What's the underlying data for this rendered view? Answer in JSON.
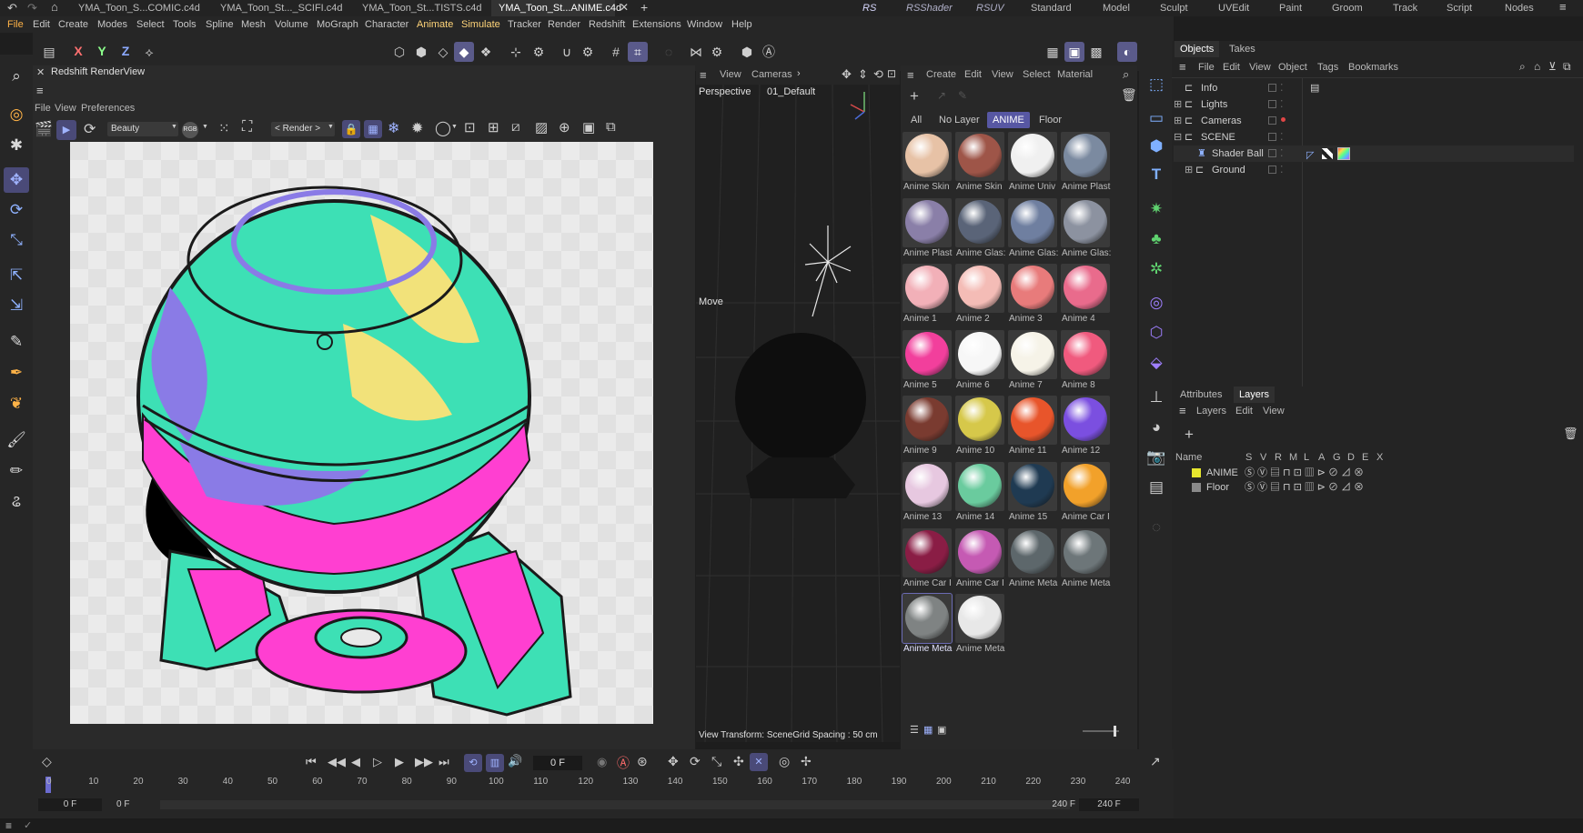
{
  "file_tabs": [
    {
      "label": "YMA_Toon_S...COMIC.c4d *",
      "active": false
    },
    {
      "label": "YMA_Toon_St..._SCIFI.c4d *",
      "active": false
    },
    {
      "label": "YMA_Toon_St...TISTS.c4d *",
      "active": false
    },
    {
      "label": "YMA_Toon_St...ANIME.c4d *",
      "active": true
    }
  ],
  "layouts": [
    "RS",
    "RSShader",
    "RSUV",
    "Standard",
    "Model",
    "Sculpt",
    "UVEdit",
    "Paint",
    "Groom",
    "Track",
    "Script",
    "Nodes"
  ],
  "main_menu": [
    "File",
    "Edit",
    "Create",
    "Modes",
    "Select",
    "Tools",
    "Spline",
    "Mesh",
    "Volume",
    "MoGraph",
    "Character",
    "Animate",
    "Simulate",
    "Tracker",
    "Render",
    "Redshift",
    "Extensions",
    "Window",
    "Help"
  ],
  "toolbar": {
    "axes": [
      "X",
      "Y",
      "Z"
    ]
  },
  "render_view": {
    "title": "Redshift RenderView",
    "menu": [
      "File",
      "View",
      "Preferences"
    ],
    "aov_value": "Beauty",
    "render_dropdown": "< Render >",
    "rgb_label": "RGB"
  },
  "viewport": {
    "menu": [
      "View",
      "Cameras"
    ],
    "camera": "Perspective",
    "camera_name": "01_Default",
    "mode_label": "Move",
    "status_text": "View Transform: SceneGrid Spacing : 50 cm"
  },
  "material_manager": {
    "menu": [
      "Create",
      "Edit",
      "View",
      "Select",
      "Material"
    ],
    "filters": [
      "All",
      "No Layer",
      "ANIME",
      "Floor"
    ],
    "active_filter": "ANIME",
    "materials": [
      {
        "label": "Anime Skin",
        "color": "#e7c2a6"
      },
      {
        "label": "Anime Skin",
        "color": "#9e5548"
      },
      {
        "label": "Anime Univ",
        "color": "#f0f0f0"
      },
      {
        "label": "Anime Plast",
        "color": "#7b8aa0"
      },
      {
        "label": "Anime Plast",
        "color": "#8a7fa8"
      },
      {
        "label": "Anime Glas:",
        "color": "#5a6478"
      },
      {
        "label": "Anime Glas:",
        "color": "#6f7fa0"
      },
      {
        "label": "Anime Glas:",
        "color": "#8c92a0"
      },
      {
        "label": "Anime 1",
        "color": "#f2b0b8"
      },
      {
        "label": "Anime 2",
        "color": "#f4bcb6"
      },
      {
        "label": "Anime 3",
        "color": "#e87b7b"
      },
      {
        "label": "Anime 4",
        "color": "#e96b8c"
      },
      {
        "label": "Anime 5",
        "color": "#f23f9c"
      },
      {
        "label": "Anime 6",
        "color": "#f7f7f7"
      },
      {
        "label": "Anime 7",
        "color": "#f6f3e8"
      },
      {
        "label": "Anime 8",
        "color": "#f05a7e"
      },
      {
        "label": "Anime 9",
        "color": "#7a3b30"
      },
      {
        "label": "Anime 10",
        "color": "#d6c84a"
      },
      {
        "label": "Anime 11",
        "color": "#e8552b"
      },
      {
        "label": "Anime 12",
        "color": "#7b4fe0"
      },
      {
        "label": "Anime 13",
        "color": "#e7c8e0"
      },
      {
        "label": "Anime 14",
        "color": "#6acb9e"
      },
      {
        "label": "Anime 15",
        "color": "#1f3a52"
      },
      {
        "label": "Anime Car I",
        "color": "#f2a12a"
      },
      {
        "label": "Anime Car I",
        "color": "#8a1d45"
      },
      {
        "label": "Anime Car I",
        "color": "#c55ab3"
      },
      {
        "label": "Anime Meta",
        "color": "#5d676b"
      },
      {
        "label": "Anime Meta",
        "color": "#6d7679"
      },
      {
        "label": "Anime Meta",
        "color": "#7f8383"
      },
      {
        "label": "Anime Meta",
        "color": "#e8e8e8"
      }
    ]
  },
  "objects_panel": {
    "tabs": [
      "Objects",
      "Takes"
    ],
    "menu": [
      "File",
      "Edit",
      "View",
      "Object",
      "Tags",
      "Bookmarks"
    ],
    "items": [
      {
        "label": "Info",
        "indent": 0
      },
      {
        "label": "Lights",
        "indent": 0
      },
      {
        "label": "Cameras",
        "indent": 0
      },
      {
        "label": "SCENE",
        "indent": 0
      },
      {
        "label": "Shader Ball",
        "indent": 1
      },
      {
        "label": "Ground",
        "indent": 1
      }
    ]
  },
  "layers_panel": {
    "tabs": [
      "Attributes",
      "Layers"
    ],
    "menu": [
      "Layers",
      "Edit",
      "View"
    ],
    "columns_header": "Name",
    "flags": [
      "S",
      "V",
      "R",
      "M",
      "L",
      "A",
      "G",
      "D",
      "E",
      "X"
    ],
    "layers": [
      {
        "name": "ANIME",
        "color": "#e6e62e"
      },
      {
        "name": "Floor",
        "color": "#8a8a8a"
      }
    ]
  },
  "timeline": {
    "current_frame": "0 F",
    "ticks": [
      "0",
      "10",
      "20",
      "30",
      "40",
      "50",
      "60",
      "70",
      "80",
      "90",
      "100",
      "110",
      "120",
      "130",
      "140",
      "150",
      "160",
      "170",
      "180",
      "190",
      "200",
      "210",
      "220",
      "230",
      "240"
    ],
    "start_field": "0 F",
    "start_field2": "0 F",
    "end_field": "240 F",
    "end_field2": "240 F"
  },
  "colors": {
    "accent": "#5757a3",
    "selection": "#4a4a78",
    "anime_layer": "#e6e62e"
  }
}
